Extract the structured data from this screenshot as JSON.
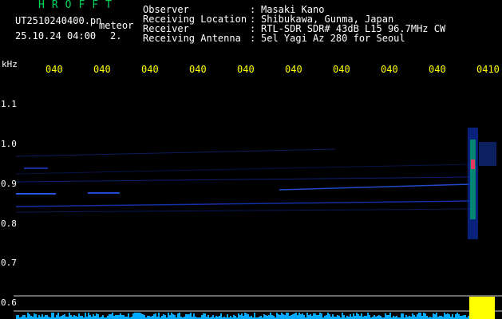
{
  "header": {
    "title": "HROFFT",
    "filename": "UT2510240400.pn",
    "tag": "meteor",
    "timestamp": "25.10.24 04:00",
    "number": "2."
  },
  "info": [
    {
      "label": "Observer",
      "value": "Masaki Kano"
    },
    {
      "label": "Receiving Location",
      "value": "Shibukawa, Gunma, Japan"
    },
    {
      "label": "Receiver",
      "value": "RTL-SDR SDR# 43dB L15 96.7MHz CW"
    },
    {
      "label": "Receiving Antenna",
      "value": "5el Yagi Az 280 for Seoul"
    }
  ],
  "axis": {
    "unit": "kHz",
    "time_ticks": [
      "040",
      "040",
      "040",
      "040",
      "040",
      "040",
      "040",
      "040",
      "040",
      "0410"
    ],
    "freq_labels": [
      "1.1",
      "1.0",
      "0.9",
      "0.8",
      "0.7",
      "0.6"
    ]
  },
  "colors": {
    "title": "#00d65a",
    "ticks": "#ffff00",
    "signal": "#2244ff",
    "meteor": "#00ff80",
    "bottom_bar": "#00aaff",
    "bottom_peak": "#ffff00"
  }
}
